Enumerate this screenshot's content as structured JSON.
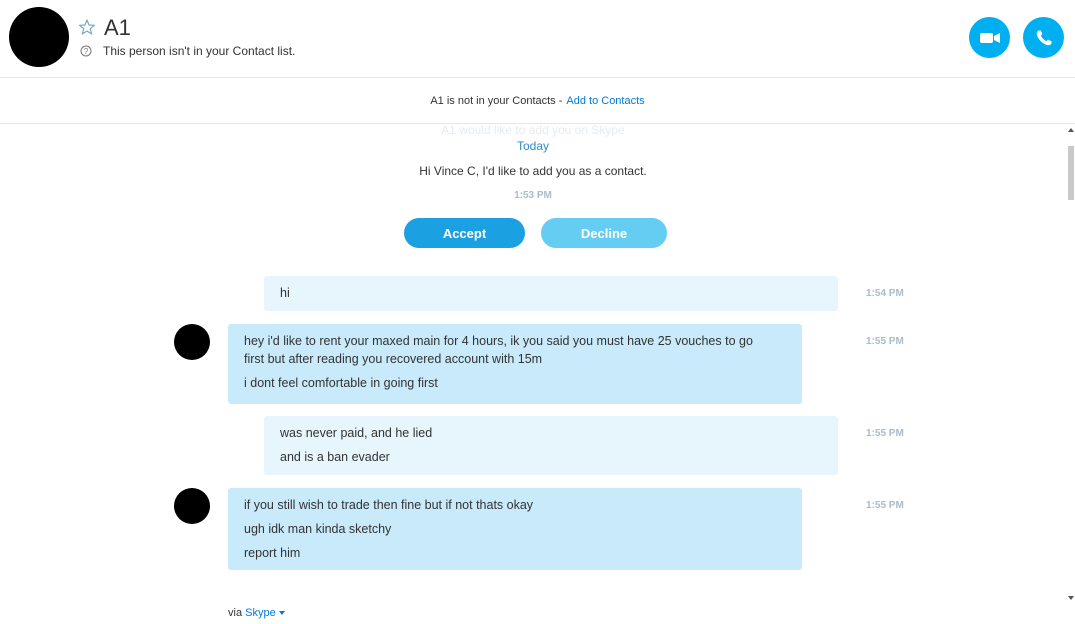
{
  "header": {
    "name": "A1",
    "status": "This person isn't in your Contact list."
  },
  "notice": {
    "text": "A1 is not in your Contacts -",
    "link": "Add to Contacts"
  },
  "request": {
    "faded": "A1 would like to add you on Skype",
    "date": "Today",
    "message": "Hi Vince C, I'd like to add you as a contact.",
    "time": "1:53 PM",
    "accept_label": "Accept",
    "decline_label": "Decline"
  },
  "messages": [
    {
      "lines": [
        "hi"
      ],
      "time": "1:54 PM"
    },
    {
      "lines": [
        "hey i'd like to rent your maxed main for 4 hours, ik you said you must have 25 vouches to go",
        "first but after reading you recovered account with 15m",
        "i dont feel comfortable in going first"
      ],
      "time": "1:55 PM"
    },
    {
      "lines": [
        "was never paid, and he lied",
        "and is a ban evader"
      ],
      "time": "1:55 PM"
    },
    {
      "lines": [
        "if you still wish to trade then fine but if not thats okay",
        "ugh idk man kinda sketchy",
        "report him"
      ],
      "time": "1:55 PM"
    }
  ],
  "footer": {
    "via": "via",
    "skype": "Skype"
  },
  "colors": {
    "accent": "#00aff0",
    "outgoing_bubble": "#e7f5fc",
    "incoming_bubble": "#c8eafa",
    "accept": "#1ba1e2",
    "decline": "#66cdf2"
  },
  "icons": {
    "star": "star-icon",
    "help": "help-circle-icon",
    "video": "video-camera-icon",
    "call": "phone-icon"
  }
}
